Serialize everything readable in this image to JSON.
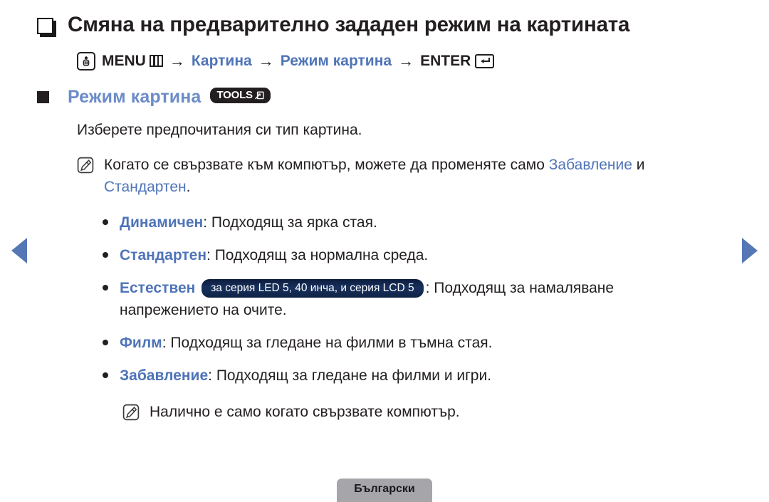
{
  "nav": {
    "prev_icon": "triangle-left-icon",
    "next_icon": "triangle-right-icon",
    "accent_color": "#5577b6"
  },
  "heading": {
    "text": "Смяна на предварително зададен режим на картината",
    "marker_icon": "square-outline-marker"
  },
  "menu_path": {
    "press_icon": "hand-press-icon",
    "menu_label": "MENU",
    "menu_icon": "menu-grid-icon",
    "arrow": "→",
    "step_1": "Картина",
    "step_2": "Режим картина",
    "enter_label": "ENTER",
    "enter_icon": "enter-return-icon",
    "accent_color": "#4f74b8"
  },
  "section": {
    "marker_icon": "filled-square-marker",
    "title": "Режим картина",
    "tools_label": "TOOLS",
    "tools_icon": "tools-arrow-icon",
    "title_color": "#6b8cc8",
    "description": "Изберете предпочитания си тип картина."
  },
  "note_top": {
    "icon": "note-pencil-icon",
    "text_before": "Когато се свързвате към компютър, можете да променяте само ",
    "highlight_1": "Забавление",
    "text_middle": " и ",
    "highlight_2": "Стандартен",
    "text_after": "."
  },
  "modes": [
    {
      "bullet_icon": "bullet-dot-icon",
      "name": "Динамичен",
      "separator": ": ",
      "description": "Подходящ за ярка стая.",
      "badge": ""
    },
    {
      "bullet_icon": "bullet-dot-icon",
      "name": "Стандартен",
      "separator": ": ",
      "description": "Подходящ за нормална среда.",
      "badge": ""
    },
    {
      "bullet_icon": "bullet-dot-icon",
      "name": "Естествен",
      "separator": ": ",
      "description": "Подходящ за намаляване напрежението на очите.",
      "badge": "за серия LED 5, 40 инча, и серия LCD 5"
    },
    {
      "bullet_icon": "bullet-dot-icon",
      "name": "Филм",
      "separator": ": ",
      "description": "Подходящ за гледане на филми в тъмна стая.",
      "badge": ""
    },
    {
      "bullet_icon": "bullet-dot-icon",
      "name": "Забавление",
      "separator": ": ",
      "description": "Подходящ за гледане на филми и игри.",
      "badge": ""
    }
  ],
  "note_bottom": {
    "icon": "note-pencil-icon",
    "text": "Налично е само когато свързвате компютър."
  },
  "footer": {
    "language": "Български",
    "background_color": "#a5a5aa"
  }
}
